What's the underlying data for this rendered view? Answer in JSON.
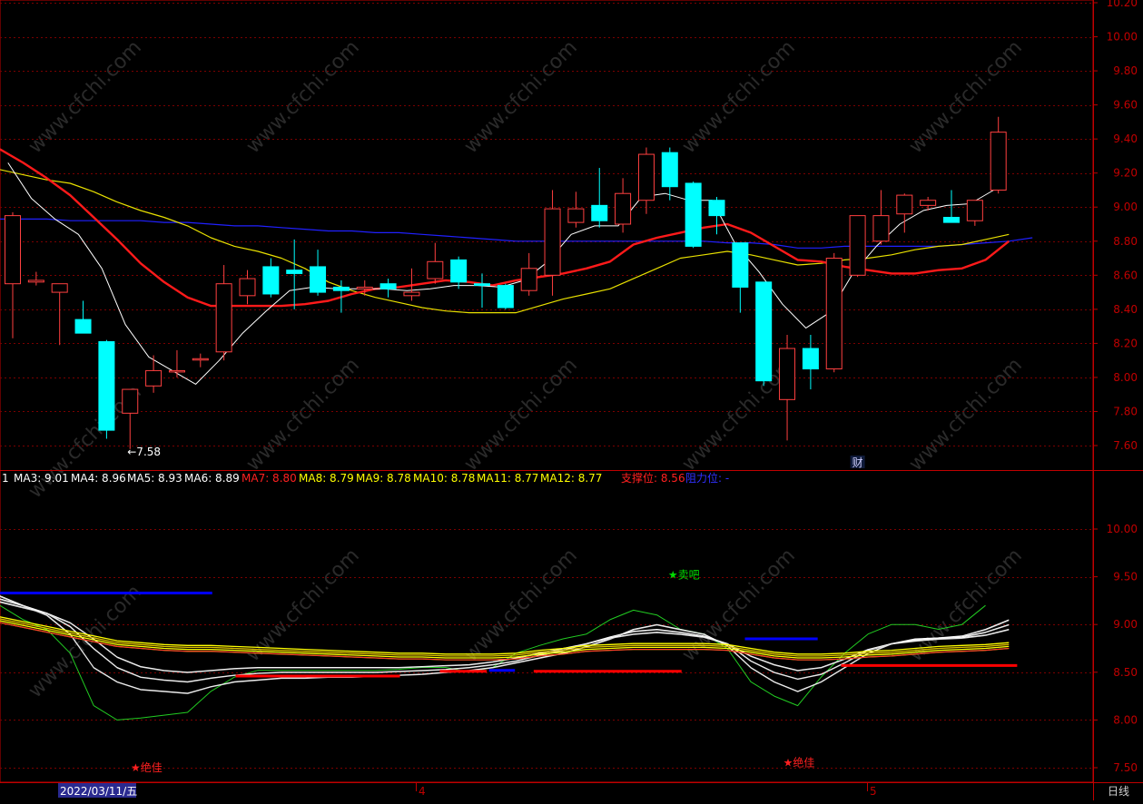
{
  "chart_data": [
    {
      "type": "candlestick",
      "panel": "main",
      "ylim": [
        7.5,
        10.2
      ],
      "y_ticks": [
        "7.60",
        "7.80",
        "8.00",
        "8.20",
        "8.40",
        "8.60",
        "8.80",
        "9.00",
        "9.20",
        "9.40",
        "9.60",
        "9.80",
        "10.00",
        "10.20"
      ],
      "candles": [
        {
          "o": 8.55,
          "h": 8.97,
          "l": 8.23,
          "c": 8.95
        },
        {
          "o": 8.56,
          "h": 8.62,
          "l": 8.54,
          "c": 8.57
        },
        {
          "o": 8.5,
          "h": 8.53,
          "l": 8.19,
          "c": 8.55
        },
        {
          "o": 8.34,
          "h": 8.45,
          "l": 8.26,
          "c": 8.26
        },
        {
          "o": 8.21,
          "h": 8.22,
          "l": 7.64,
          "c": 7.69
        },
        {
          "o": 7.79,
          "h": 7.92,
          "l": 7.58,
          "c": 7.93
        },
        {
          "o": 7.95,
          "h": 8.13,
          "l": 7.91,
          "c": 8.04
        },
        {
          "o": 8.04,
          "h": 8.16,
          "l": 8.0,
          "c": 8.04
        },
        {
          "o": 8.11,
          "h": 8.14,
          "l": 8.06,
          "c": 8.11
        },
        {
          "o": 8.15,
          "h": 8.66,
          "l": 8.1,
          "c": 8.55
        },
        {
          "o": 8.48,
          "h": 8.63,
          "l": 8.43,
          "c": 8.58
        },
        {
          "o": 8.65,
          "h": 8.7,
          "l": 8.47,
          "c": 8.49
        },
        {
          "o": 8.63,
          "h": 8.81,
          "l": 8.4,
          "c": 8.61
        },
        {
          "o": 8.65,
          "h": 8.75,
          "l": 8.48,
          "c": 8.5
        },
        {
          "o": 8.53,
          "h": 8.57,
          "l": 8.38,
          "c": 8.51
        },
        {
          "o": 8.52,
          "h": 8.57,
          "l": 8.48,
          "c": 8.53
        },
        {
          "o": 8.55,
          "h": 8.58,
          "l": 8.47,
          "c": 8.52
        },
        {
          "o": 8.48,
          "h": 8.64,
          "l": 8.45,
          "c": 8.5
        },
        {
          "o": 8.58,
          "h": 8.79,
          "l": 8.55,
          "c": 8.68
        },
        {
          "o": 8.69,
          "h": 8.71,
          "l": 8.52,
          "c": 8.56
        },
        {
          "o": 8.55,
          "h": 8.61,
          "l": 8.41,
          "c": 8.54
        },
        {
          "o": 8.54,
          "h": 8.55,
          "l": 8.4,
          "c": 8.41
        },
        {
          "o": 8.51,
          "h": 8.73,
          "l": 8.48,
          "c": 8.64
        },
        {
          "o": 8.6,
          "h": 9.1,
          "l": 8.48,
          "c": 8.99
        },
        {
          "o": 8.91,
          "h": 9.09,
          "l": 8.88,
          "c": 8.99
        },
        {
          "o": 9.01,
          "h": 9.23,
          "l": 8.88,
          "c": 8.92
        },
        {
          "o": 8.9,
          "h": 9.17,
          "l": 8.85,
          "c": 9.08
        },
        {
          "o": 9.04,
          "h": 9.35,
          "l": 8.96,
          "c": 9.31
        },
        {
          "o": 9.32,
          "h": 9.35,
          "l": 9.04,
          "c": 9.12
        },
        {
          "o": 9.14,
          "h": 9.15,
          "l": 8.76,
          "c": 8.77
        },
        {
          "o": 9.04,
          "h": 9.06,
          "l": 8.84,
          "c": 8.95
        },
        {
          "o": 8.79,
          "h": 8.79,
          "l": 8.38,
          "c": 8.53
        },
        {
          "o": 8.56,
          "h": 8.56,
          "l": 7.95,
          "c": 7.98
        },
        {
          "o": 7.87,
          "h": 8.25,
          "l": 7.63,
          "c": 8.17
        },
        {
          "o": 8.17,
          "h": 8.25,
          "l": 7.93,
          "c": 8.05
        },
        {
          "o": 8.05,
          "h": 8.73,
          "l": 8.03,
          "c": 8.7
        },
        {
          "o": 8.6,
          "h": 8.95,
          "l": 8.59,
          "c": 8.95
        },
        {
          "o": 8.8,
          "h": 9.1,
          "l": 8.78,
          "c": 8.95
        },
        {
          "o": 8.96,
          "h": 9.08,
          "l": 8.85,
          "c": 9.07
        },
        {
          "o": 9.01,
          "h": 9.06,
          "l": 8.98,
          "c": 9.04
        },
        {
          "o": 8.94,
          "h": 9.1,
          "l": 8.91,
          "c": 8.91
        },
        {
          "o": 8.92,
          "h": 9.04,
          "l": 8.89,
          "c": 9.04
        },
        {
          "o": 9.1,
          "h": 9.53,
          "l": 9.08,
          "c": 9.44
        }
      ],
      "ma_white": [
        9.26,
        9.05,
        8.93,
        8.84,
        8.64,
        8.31,
        8.12,
        8.04,
        7.96,
        8.1,
        8.26,
        8.39,
        8.51,
        8.53,
        8.52,
        8.52,
        8.52,
        8.51,
        8.52,
        8.54,
        8.54,
        8.53,
        8.57,
        8.68,
        8.84,
        8.89,
        8.89,
        9.06,
        9.08,
        9.04,
        9.04,
        8.78,
        8.62,
        8.43,
        8.29,
        8.38,
        8.61,
        8.77,
        8.9,
        8.98,
        9.01,
        9.02,
        9.1
      ],
      "ma_red": [
        9.34,
        9.26,
        9.17,
        9.07,
        8.94,
        8.81,
        8.67,
        8.56,
        8.47,
        8.42,
        8.42,
        8.42,
        8.42,
        8.43,
        8.45,
        8.49,
        8.52,
        8.53,
        8.55,
        8.57,
        8.56,
        8.54,
        8.57,
        8.59,
        8.61,
        8.64,
        8.68,
        8.78,
        8.82,
        8.85,
        8.88,
        8.9,
        8.85,
        8.77,
        8.69,
        8.68,
        8.65,
        8.63,
        8.61,
        8.61,
        8.63,
        8.64,
        8.69,
        8.8
      ],
      "ma_yellow": [
        9.22,
        9.19,
        9.16,
        9.14,
        9.09,
        9.03,
        8.98,
        8.94,
        8.89,
        8.82,
        8.77,
        8.74,
        8.7,
        8.64,
        8.56,
        8.51,
        8.47,
        8.44,
        8.41,
        8.39,
        8.38,
        8.38,
        8.38,
        8.42,
        8.46,
        8.49,
        8.52,
        8.58,
        8.64,
        8.7,
        8.72,
        8.74,
        8.72,
        8.69,
        8.66,
        8.67,
        8.69,
        8.7,
        8.72,
        8.75,
        8.77,
        8.78,
        8.81,
        8.84
      ],
      "ma_blue": [
        8.93,
        8.93,
        8.93,
        8.92,
        8.92,
        8.92,
        8.92,
        8.91,
        8.91,
        8.9,
        8.89,
        8.89,
        8.88,
        8.87,
        8.86,
        8.86,
        8.85,
        8.85,
        8.84,
        8.83,
        8.82,
        8.81,
        8.8,
        8.8,
        8.8,
        8.8,
        8.8,
        8.8,
        8.8,
        8.8,
        8.8,
        8.79,
        8.79,
        8.78,
        8.76,
        8.76,
        8.77,
        8.77,
        8.77,
        8.77,
        8.77,
        8.78,
        8.79,
        8.8,
        8.82
      ],
      "annotations": [
        {
          "text": "←7.58",
          "candle": 5
        },
        {
          "text": "财",
          "candle": 36
        }
      ]
    },
    {
      "type": "line",
      "panel": "lower",
      "ylim": [
        7.4,
        10.6
      ],
      "y_ticks": [
        "7.50",
        "8.00",
        "8.50",
        "9.00",
        "9.50",
        "10.00"
      ],
      "fan_white": [
        [
          9.3,
          9.2,
          9.1,
          8.9,
          8.55,
          8.4,
          8.32,
          8.3,
          8.28,
          8.35,
          8.4,
          8.42,
          8.44,
          8.44,
          8.45,
          8.45,
          8.46,
          8.47,
          8.48,
          8.5,
          8.52,
          8.55,
          8.6,
          8.65,
          8.7,
          8.77,
          8.85,
          8.95,
          9.0,
          8.95,
          8.9,
          8.78,
          8.55,
          8.4,
          8.3,
          8.4,
          8.55,
          8.7,
          8.8,
          8.85,
          8.86,
          8.88,
          8.95,
          9.05
        ],
        [
          9.27,
          9.2,
          9.12,
          8.98,
          8.75,
          8.55,
          8.45,
          8.42,
          8.4,
          8.44,
          8.47,
          8.49,
          8.5,
          8.5,
          8.5,
          8.5,
          8.5,
          8.51,
          8.52,
          8.53,
          8.55,
          8.58,
          8.62,
          8.68,
          8.73,
          8.8,
          8.87,
          8.93,
          8.95,
          8.92,
          8.88,
          8.8,
          8.62,
          8.5,
          8.43,
          8.48,
          8.6,
          8.73,
          8.8,
          8.84,
          8.86,
          8.87,
          8.92,
          9.0
        ],
        [
          9.24,
          9.18,
          9.12,
          9.02,
          8.85,
          8.66,
          8.56,
          8.52,
          8.5,
          8.52,
          8.54,
          8.55,
          8.55,
          8.55,
          8.55,
          8.55,
          8.55,
          8.55,
          8.56,
          8.57,
          8.58,
          8.61,
          8.65,
          8.7,
          8.75,
          8.8,
          8.86,
          8.9,
          8.92,
          8.9,
          8.87,
          8.8,
          8.67,
          8.58,
          8.52,
          8.55,
          8.64,
          8.74,
          8.8,
          8.83,
          8.85,
          8.86,
          8.89,
          8.95
        ]
      ],
      "fan_green": [
        9.2,
        9.05,
        8.95,
        8.7,
        8.15,
        8.0,
        8.02,
        8.05,
        8.08,
        8.3,
        8.45,
        8.52,
        8.52,
        8.52,
        8.52,
        8.52,
        8.52,
        8.53,
        8.55,
        8.55,
        8.5,
        8.55,
        8.7,
        8.78,
        8.85,
        8.9,
        9.05,
        9.15,
        9.1,
        8.95,
        8.9,
        8.75,
        8.4,
        8.25,
        8.15,
        8.45,
        8.7,
        8.9,
        9.0,
        9.0,
        8.95,
        9.0,
        9.2
      ],
      "fan_yellow": [
        9.05,
        9.0,
        8.95,
        8.9,
        8.85,
        8.8,
        8.78,
        8.76,
        8.75,
        8.75,
        8.74,
        8.73,
        8.72,
        8.71,
        8.7,
        8.69,
        8.68,
        8.67,
        8.67,
        8.66,
        8.66,
        8.66,
        8.67,
        8.7,
        8.72,
        8.75,
        8.76,
        8.77,
        8.77,
        8.77,
        8.77,
        8.76,
        8.72,
        8.68,
        8.66,
        8.66,
        8.67,
        8.69,
        8.7,
        8.72,
        8.74,
        8.75,
        8.76,
        8.78
      ],
      "bars": [
        {
          "color": "#0000ff",
          "y": 9.33,
          "x0": 0,
          "x1": 8.5
        },
        {
          "color": "#ff0000",
          "y": 8.46,
          "x0": 9.5,
          "x1": 16.5
        },
        {
          "color": "#ff0000",
          "y": 8.51,
          "x0": 18.2,
          "x1": 20.2
        },
        {
          "color": "#0000ff",
          "y": 8.52,
          "x0": 20.3,
          "x1": 21.4
        },
        {
          "color": "#ff0000",
          "y": 8.51,
          "x0": 22.2,
          "x1": 28.5
        },
        {
          "color": "#0000ff",
          "y": 8.85,
          "x0": 31.2,
          "x1": 34.3
        },
        {
          "color": "#ff0000",
          "y": 8.57,
          "x0": 35.3,
          "x1": 42.8
        }
      ],
      "markers": [
        {
          "text": "★绝佳",
          "candle": 5.7,
          "y": 7.5,
          "color": "#ff2020"
        },
        {
          "text": "★卖吧",
          "candle": 28.6,
          "y": 9.52,
          "color": "#00dd00"
        },
        {
          "text": "★绝佳",
          "candle": 33.5,
          "y": 7.55,
          "color": "#ff2020"
        }
      ]
    }
  ],
  "legend": [
    {
      "text": "1",
      "color": "#ffffff"
    },
    {
      "text": "MA3: 9.01",
      "color": "#ffffff"
    },
    {
      "text": "MA4: 8.96",
      "color": "#ffffff"
    },
    {
      "text": "MA5: 8.93",
      "color": "#ffffff"
    },
    {
      "text": "MA6: 8.89",
      "color": "#ffffff"
    },
    {
      "text": "MA7: 8.80",
      "color": "#ff2020"
    },
    {
      "text": "MA8: 8.79",
      "color": "#ffff00"
    },
    {
      "text": "MA9: 8.78",
      "color": "#ffff00"
    },
    {
      "text": "MA10: 8.78",
      "color": "#ffff00"
    },
    {
      "text": "MA11: 8.77",
      "color": "#ffff00"
    },
    {
      "text": "MA12: 8.77",
      "color": "#ffff00"
    },
    {
      "text": "支撑位: 8.56",
      "color": "#ff2020"
    },
    {
      "text": "阻力位: -",
      "color": "#3030ff"
    }
  ],
  "bottom_axis": {
    "date_label": "2022/03/11/五",
    "month_4": "4",
    "month_5": "5",
    "period_label": "日线"
  },
  "watermark": "www.cfchi.com",
  "colors": {
    "up": "#ff4040",
    "down": "#00ffff",
    "grid": "#7a0000",
    "axis": "#c00000"
  }
}
